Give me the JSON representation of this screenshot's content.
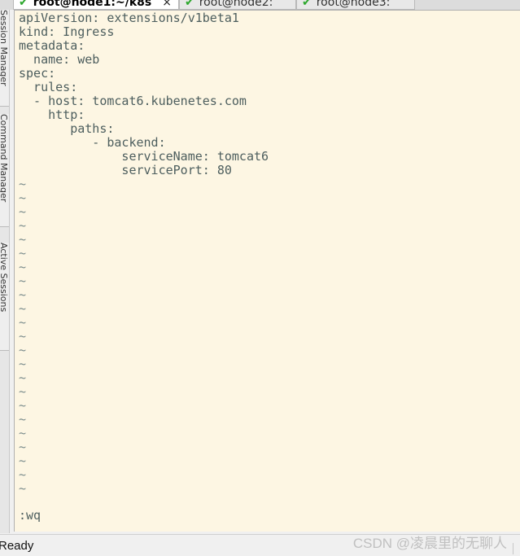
{
  "tabs": [
    {
      "label": "root@node1:~/k8s",
      "active": true,
      "status_icon": "check-icon",
      "close": "×"
    },
    {
      "label": "root@node2:",
      "active": false,
      "status_icon": "check-icon"
    },
    {
      "label": "root@node3:",
      "active": false,
      "status_icon": "check-icon"
    }
  ],
  "side_panel": {
    "tabs": [
      "Session Manager",
      "Command Manager",
      "Active Sessions"
    ]
  },
  "editor": {
    "lines": [
      "apiVersion: extensions/v1beta1",
      "kind: Ingress",
      "metadata:",
      "  name: web",
      "spec:",
      "  rules:",
      "  - host: tomcat6.kubenetes.com",
      "    http:",
      "       paths:",
      "          - backend:",
      "              serviceName: tomcat6",
      "              servicePort: 80"
    ],
    "tilde": "~",
    "tilde_count": 23,
    "command_line": ":wq",
    "colors": {
      "background": "#fdf6e3",
      "text": "#4d5e5e"
    }
  },
  "status_bar": {
    "status": "Ready",
    "watermark": "CSDN @凌晨里的无聊人"
  }
}
